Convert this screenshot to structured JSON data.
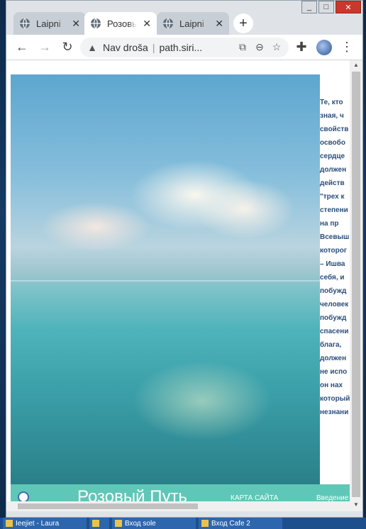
{
  "tabs": [
    {
      "title": "Laipni",
      "active": false
    },
    {
      "title": "Розовы",
      "active": true
    },
    {
      "title": "Laipni",
      "active": false
    }
  ],
  "toolbar": {
    "security_label": "Nav droša",
    "url": "path.siri..."
  },
  "article": {
    "lines": [
      "Те, кто",
      "зная, ч",
      "свойств",
      "освобо",
      "сердце",
      "должен",
      "действ",
      "\"трех к",
      "степени",
      "на пр",
      "Всевыш",
      "которог",
      "– Ишва",
      "себя, и",
      "побужд",
      "человек",
      "побужд",
      "спасени",
      "блага,",
      "должен",
      "не испо",
      "он нах",
      "который",
      "незнани"
    ]
  },
  "footer": {
    "site_title": "Розовый Путь",
    "sitemap_label": "КАРТА САЙТА",
    "intro_label": "Введение"
  },
  "taskbar": {
    "items": [
      "Ieejiet - Laura",
      "",
      "Вход sole",
      "Вход Cafe 2",
      "",
      ""
    ]
  }
}
